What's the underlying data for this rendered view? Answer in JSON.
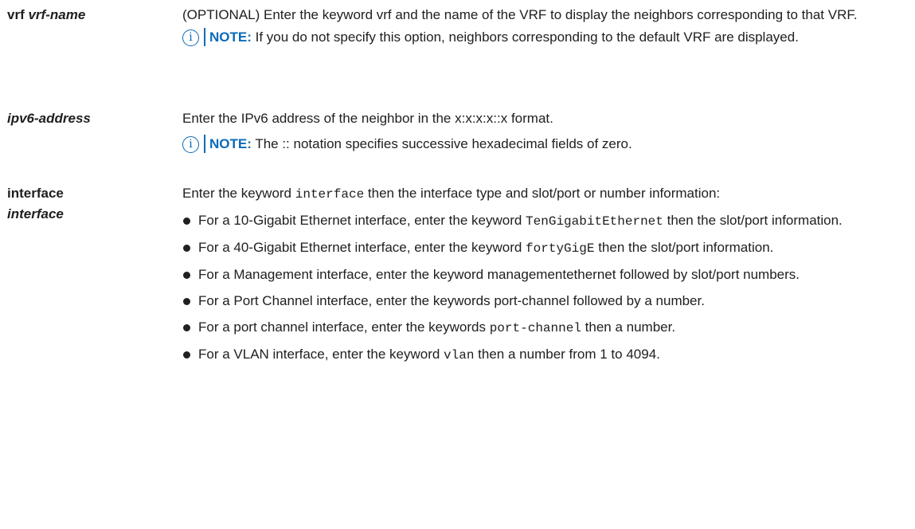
{
  "rows": [
    {
      "term": "vrf",
      "term_param": "vrf-name",
      "desc": "(OPTIONAL) Enter the keyword vrf and the name of the VRF to display the neighbors corresponding to that VRF.",
      "note_label": "NOTE:",
      "note_text": "If you do not specify this option, neighbors corresponding to the default VRF are displayed."
    },
    {
      "term_param": "ipv6-address",
      "desc": "Enter the IPv6 address of the neighbor in the x:x:x:x::x format.",
      "note_label": "NOTE:",
      "note_text": "The :: notation specifies successive hexadecimal fields of zero."
    },
    {
      "term": "interface",
      "term_param": "interface",
      "desc_pre": "Enter the keyword ",
      "desc_code": "interface",
      "desc_post": " then the interface type and slot/port or number information:",
      "bullets": [
        {
          "pre": "For a 10-Gigabit Ethernet interface, enter the keyword ",
          "code": "TenGigabitEthernet",
          "post": " then the slot/port information."
        },
        {
          "pre": "For a 40-Gigabit Ethernet interface, enter the keyword ",
          "code": "fortyGigE",
          "post": " then the slot/port information."
        },
        {
          "pre": "For a Management interface, enter the keyword managementethernet followed by slot/port numbers.",
          "code": "",
          "post": ""
        },
        {
          "pre": "For a Port Channel interface, enter the keywords port-channel followed by a number.",
          "code": "",
          "post": ""
        },
        {
          "pre": "For a port channel interface, enter the keywords ",
          "code": "port-channel",
          "post": " then a number."
        },
        {
          "pre": "For a VLAN interface, enter the keyword ",
          "code": "vlan",
          "post": " then a number from 1 to 4094."
        }
      ]
    }
  ],
  "icons": {
    "note": "info-icon",
    "note_color": "#0a6bb8"
  }
}
